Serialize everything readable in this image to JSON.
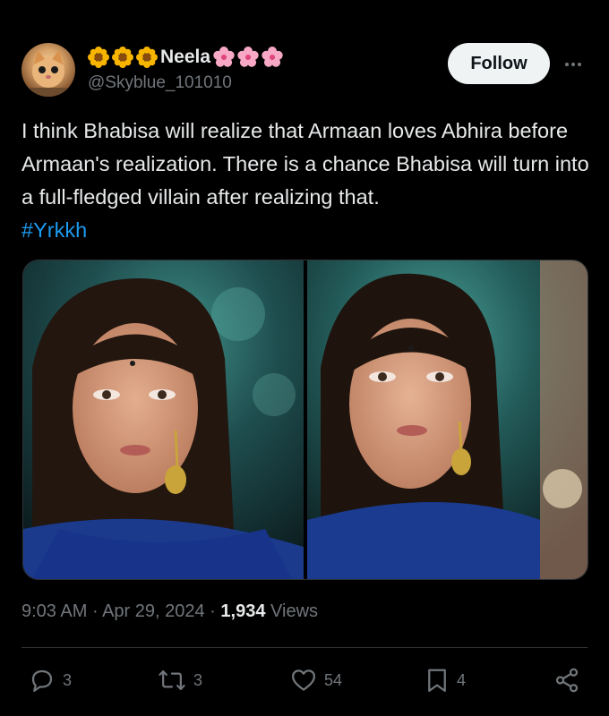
{
  "author": {
    "name": "Neela",
    "handle": "@Skyblue_101010",
    "prefix_emojis": [
      "sunflower-icon",
      "sunflower-icon",
      "sunflower-icon"
    ],
    "suffix_emojis": [
      "cherry-blossom-icon",
      "cherry-blossom-icon",
      "cherry-blossom-icon"
    ]
  },
  "follow_label": "Follow",
  "tweet": {
    "text": "I think Bhabisa will realize that Armaan loves Abhira before Armaan's realization. There is a chance Bhabisa will turn into a full-fledged villain after realizing that.",
    "hashtag": "#Yrkkh"
  },
  "meta": {
    "time": "9:03 AM",
    "separator": "·",
    "date": "Apr 29, 2024",
    "views_count": "1,934",
    "views_label": "Views"
  },
  "actions": {
    "replies": "3",
    "reposts": "3",
    "likes": "54",
    "bookmarks": "4"
  },
  "colors": {
    "background": "#000000",
    "text": "#e7e9ea",
    "muted": "#71767b",
    "link": "#1d9bf0",
    "divider": "#2f3336",
    "follow_bg": "#eff3f4"
  }
}
